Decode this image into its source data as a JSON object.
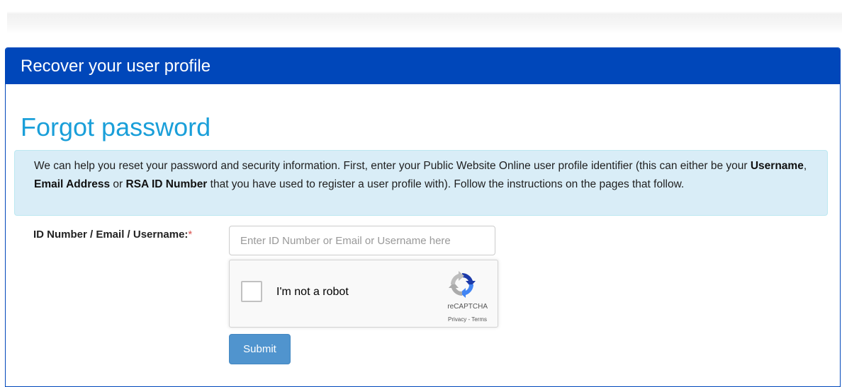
{
  "panel": {
    "heading": "Recover your user profile"
  },
  "page_title": "Forgot password",
  "info": {
    "part1": "We can help you reset your password and security information. First, enter your Public Website Online user profile identifier (this can either be your ",
    "username": "Username",
    "sep1": ", ",
    "email": "Email Address",
    "sep2": " or ",
    "rsa": "RSA ID Number",
    "part2": " that you have used to register a user profile with). Follow the instructions on the pages that follow."
  },
  "form": {
    "id_label": "ID Number / Email / Username:",
    "required_mark": "*",
    "id_placeholder": "Enter ID Number or Email or Username here",
    "id_value": "",
    "submit_label": "Submit"
  },
  "captcha": {
    "label": "I'm not a robot",
    "brand": "reCAPTCHA",
    "privacy": "Privacy",
    "separator": " - ",
    "terms": "Terms",
    "icon": "recaptcha-logo-icon"
  },
  "colors": {
    "header_bg": "#0047ba",
    "title": "#1a9fd9",
    "info_bg": "#d9edf7",
    "submit_bg": "#428bca",
    "required": "#d9534f"
  }
}
